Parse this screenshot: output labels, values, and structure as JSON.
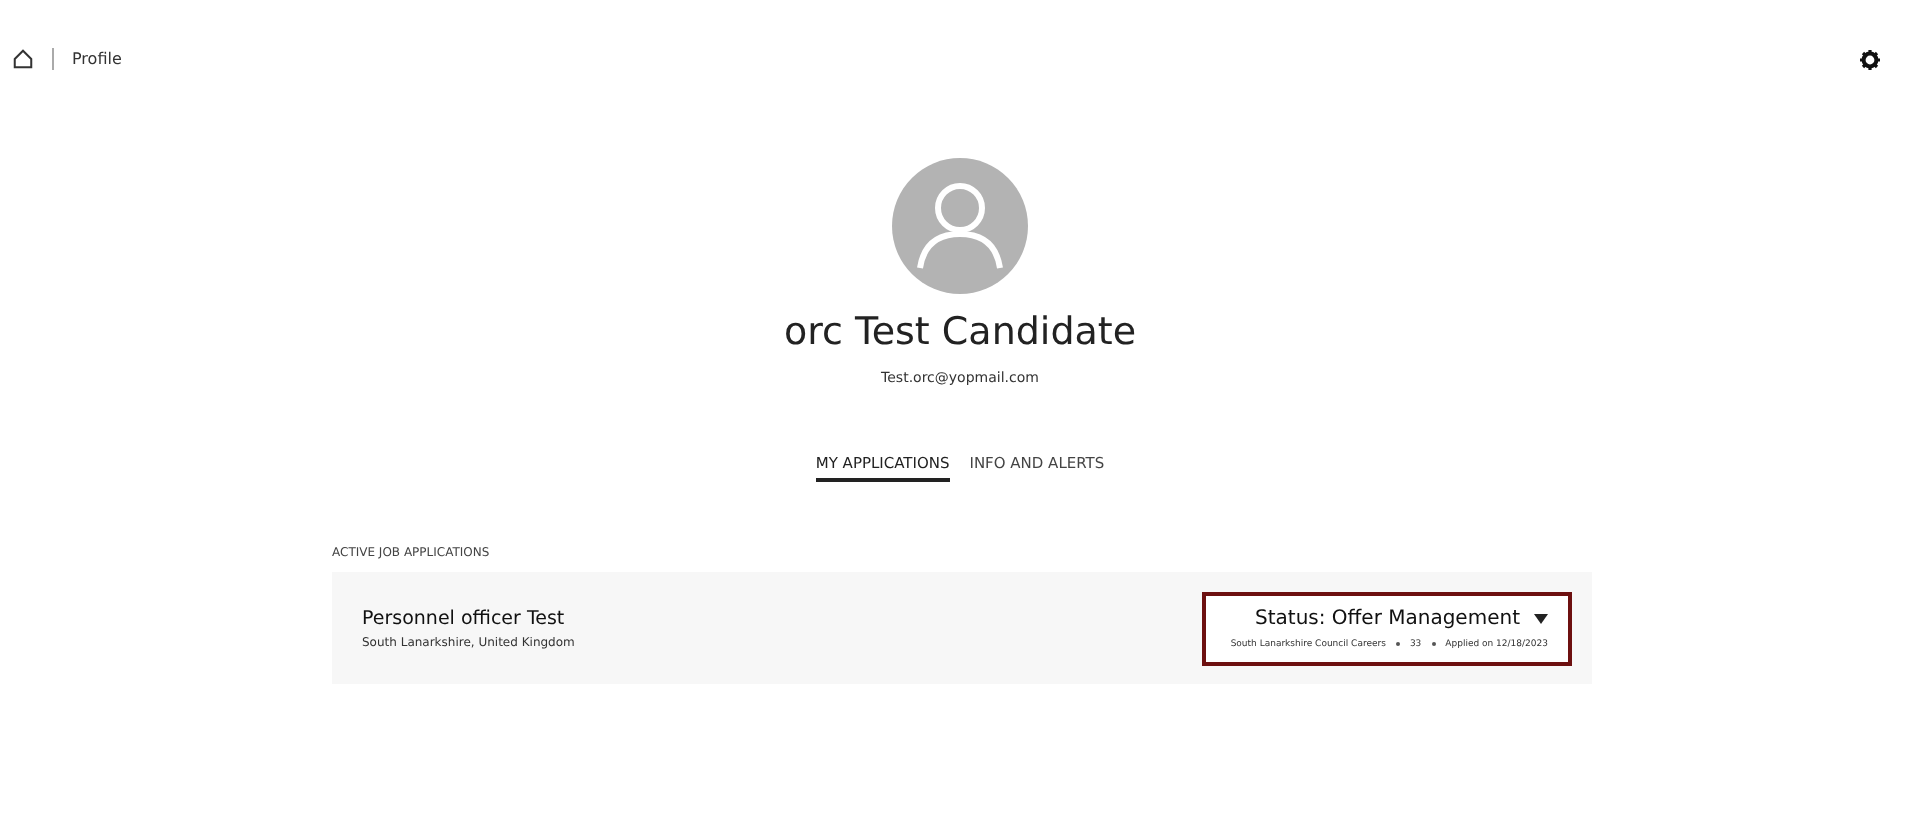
{
  "breadcrumb": {
    "current": "Profile"
  },
  "profile": {
    "name": "orc Test Candidate",
    "email": "Test.orc@yopmail.com"
  },
  "tabs": [
    {
      "label": "MY APPLICATIONS",
      "selected": true
    },
    {
      "label": "INFO AND ALERTS",
      "selected": false
    }
  ],
  "section_title": "ACTIVE JOB APPLICATIONS",
  "applications": [
    {
      "title": "Personnel officer Test",
      "location": "South Lanarkshire, United Kingdom",
      "status": "Status: Offer Management",
      "highlighted": true,
      "meta": [
        "South Lanarkshire Council Careers",
        "33",
        "Applied on 12/18/2023"
      ]
    }
  ]
}
